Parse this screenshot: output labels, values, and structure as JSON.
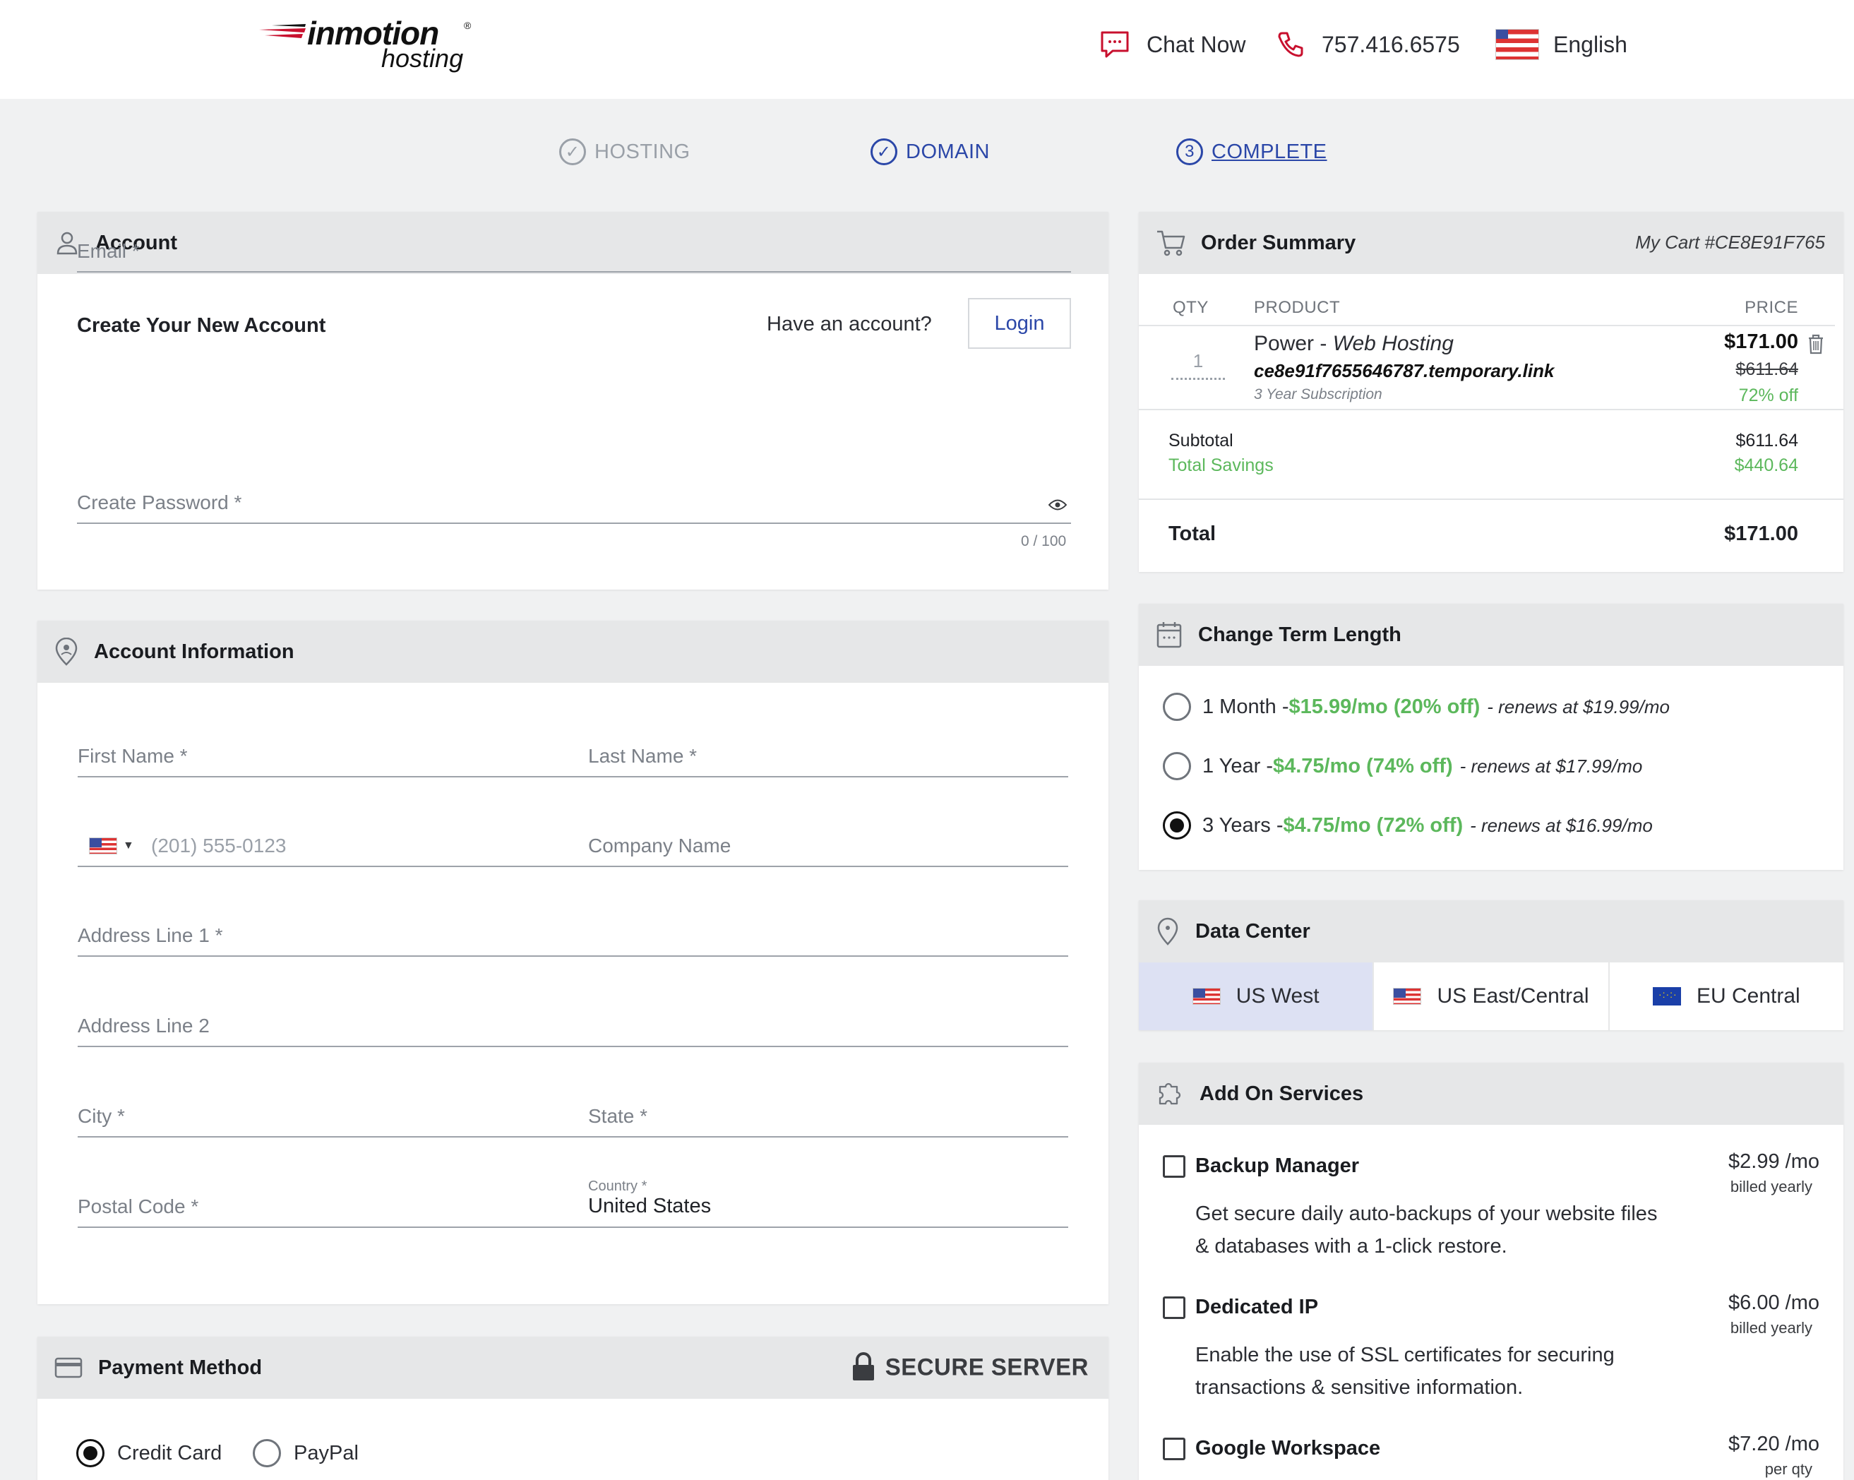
{
  "header": {
    "logo": {
      "brand": "inmotion",
      "sub": "hosting",
      "reg": "®"
    },
    "chat_label": "Chat Now",
    "phone": "757.416.6575",
    "language": "English"
  },
  "steps": [
    {
      "num": "",
      "label": "HOSTING"
    },
    {
      "num": "",
      "label": "DOMAIN"
    },
    {
      "num": "3",
      "label": "COMPLETE"
    }
  ],
  "account": {
    "title": "Account",
    "create_title": "Create Your New Account",
    "have_account": "Have an account?",
    "login_label": "Login",
    "email_placeholder": "Email *",
    "password_placeholder": "Create Password *",
    "password_counter": "0 / 100"
  },
  "account_info": {
    "title": "Account Information",
    "first_name": "First Name *",
    "last_name": "Last Name *",
    "phone_placeholder": "(201) 555-0123",
    "company": "Company Name",
    "address1": "Address Line 1 *",
    "address2": "Address Line 2",
    "city": "City *",
    "state": "State *",
    "postal": "Postal Code *",
    "country_label": "Country *",
    "country_value": "United States"
  },
  "payment": {
    "title": "Payment Method",
    "secure_label": "SECURE SERVER",
    "options": [
      "Credit Card",
      "PayPal"
    ],
    "selected": "Credit Card"
  },
  "order": {
    "title": "Order Summary",
    "cart_id": "My Cart #CE8E91F765",
    "col_qty": "QTY",
    "col_product": "PRODUCT",
    "col_price": "PRICE",
    "item": {
      "qty": "1",
      "name": "Power - ",
      "type": "Web Hosting",
      "domain": "ce8e91f7655646787.temporary.link",
      "term": "3 Year Subscription",
      "price": "$171.00",
      "was": "$611.64",
      "off": "72% off"
    },
    "subtotal_label": "Subtotal",
    "subtotal": "$611.64",
    "savings_label": "Total Savings",
    "savings": "$440.64",
    "total_label": "Total",
    "total": "$171.00"
  },
  "term": {
    "title": "Change Term Length",
    "options": [
      {
        "label": "1 Month - ",
        "deal": "$15.99/mo (20% off)",
        "renew": "- renews at $19.99/mo",
        "selected": false
      },
      {
        "label": "1 Year - ",
        "deal": "$4.75/mo (74% off)",
        "renew": "- renews at $17.99/mo",
        "selected": false
      },
      {
        "label": "3 Years - ",
        "deal": "$4.75/mo (72% off)",
        "renew": "- renews at $16.99/mo",
        "selected": true
      }
    ]
  },
  "datacenter": {
    "title": "Data Center",
    "options": [
      "US West",
      "US East/Central",
      "EU Central"
    ],
    "selected": "US West"
  },
  "addons": {
    "title": "Add On Services",
    "items": [
      {
        "name": "Backup Manager",
        "price": "$2.99 /mo",
        "period": "billed yearly",
        "desc": "Get secure daily auto-backups of your website files & databases with a 1-click restore."
      },
      {
        "name": "Dedicated IP",
        "price": "$6.00 /mo",
        "period": "billed yearly",
        "desc": "Enable the use of SSL certificates for securing transactions & sensitive information."
      },
      {
        "name": "Google Workspace",
        "price": "$7.20 /mo",
        "period": "per qty",
        "desc": ""
      }
    ]
  },
  "colors": {
    "accent": "#2b47a8",
    "green": "#5cb85c",
    "panel_header": "#e6e7e8",
    "dc_active": "#dde1f3"
  }
}
